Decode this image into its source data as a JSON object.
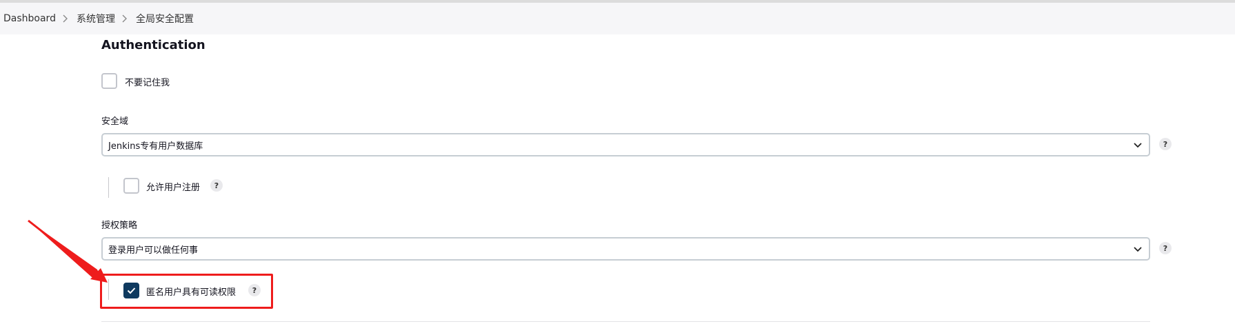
{
  "breadcrumb": {
    "items": [
      "Dashboard",
      "系统管理",
      "全局安全配置"
    ]
  },
  "authentication": {
    "title": "Authentication",
    "remember_me": {
      "label": "不要记住我",
      "checked": false
    }
  },
  "security_realm": {
    "label": "安全域",
    "selected": "Jenkins专有用户数据库",
    "help": "?",
    "allow_signup": {
      "label": "允许用户注册",
      "checked": false,
      "help": "?"
    }
  },
  "authorization": {
    "label": "授权策略",
    "selected": "登录用户可以做任何事",
    "help": "?",
    "anonymous_read": {
      "label": "匿名用户具有可读权限",
      "checked": true,
      "help": "?"
    }
  },
  "colors": {
    "accent": "#0f3a5f",
    "annotation": "#ee1c1c"
  }
}
